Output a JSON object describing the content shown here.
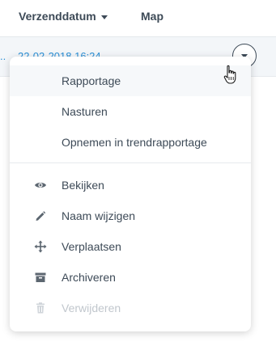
{
  "header": {
    "sort_column": "Verzenddatum",
    "map_column": "Map"
  },
  "row": {
    "ellipsis": "..",
    "date": "22-02-2018 16:24"
  },
  "menu": {
    "items": [
      {
        "label": "Rapportage"
      },
      {
        "label": "Nasturen"
      },
      {
        "label": "Opnemen in trendrapportage"
      },
      {
        "label": "Bekijken",
        "icon": "eye-icon"
      },
      {
        "label": "Naam wijzigen",
        "icon": "pencil-icon"
      },
      {
        "label": "Verplaatsen",
        "icon": "move-icon"
      },
      {
        "label": "Archiveren",
        "icon": "archive-icon"
      },
      {
        "label": "Verwijderen",
        "icon": "trash-icon",
        "disabled": true
      }
    ]
  }
}
